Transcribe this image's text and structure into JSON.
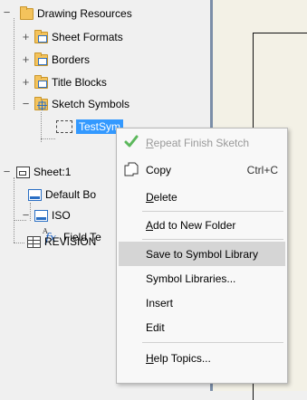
{
  "tree": {
    "drawing_resources": "Drawing Resources",
    "sheet_formats": "Sheet Formats",
    "borders": "Borders",
    "title_blocks": "Title Blocks",
    "sketch_symbols": "Sketch Symbols",
    "test_sym": "TestSym",
    "sheet1": "Sheet:1",
    "default_border": "Default Bo",
    "iso": "ISO",
    "field_text": "Field Te",
    "revision": "REVISION"
  },
  "menu": {
    "repeat_finish_sketch": {
      "pre": "",
      "key": "R",
      "post": "epeat Finish Sketch"
    },
    "copy": {
      "label": "Copy",
      "shortcut": "Ctrl+C"
    },
    "delete": {
      "pre": "",
      "key": "D",
      "post": "elete"
    },
    "add_to_new_folder": {
      "pre": "",
      "key": "A",
      "post": "dd to New Folder"
    },
    "save_to_symbol_library": "Save to Symbol Library",
    "symbol_libraries": "Symbol Libraries...",
    "insert": "Insert",
    "edit": "Edit",
    "help_topics": {
      "pre": "",
      "key": "H",
      "post": "elp Topics..."
    }
  },
  "colors": {
    "selection": "#3399ff",
    "menu_highlight": "#d5d5d5",
    "check_green": "#5cb85c"
  }
}
